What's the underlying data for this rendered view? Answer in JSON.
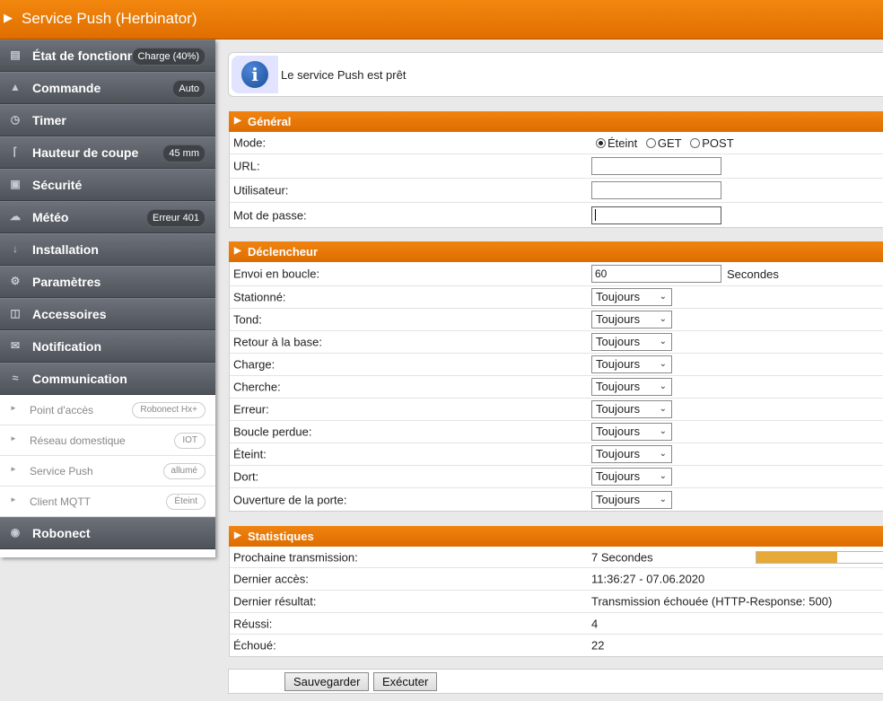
{
  "header": {
    "title": "Service Push (Herbinator)"
  },
  "sidebar": {
    "items": [
      {
        "label": "État de fonctionnement",
        "badge": "Charge (40%)",
        "icon": "chart-icon"
      },
      {
        "label": "Commande",
        "badge": "Auto",
        "icon": "joystick-icon"
      },
      {
        "label": "Timer",
        "badge": "",
        "icon": "clock-icon"
      },
      {
        "label": "Hauteur de coupe",
        "badge": "45 mm",
        "icon": "grass-icon"
      },
      {
        "label": "Sécurité",
        "badge": "",
        "icon": "lock-icon"
      },
      {
        "label": "Météo",
        "badge": "Erreur 401",
        "icon": "weather-icon"
      },
      {
        "label": "Installation",
        "badge": "",
        "icon": "install-icon"
      },
      {
        "label": "Paramètres",
        "badge": "",
        "icon": "gear-icon"
      },
      {
        "label": "Accessoires",
        "badge": "",
        "icon": "accessories-icon"
      },
      {
        "label": "Notification",
        "badge": "",
        "icon": "envelope-icon"
      },
      {
        "label": "Communication",
        "badge": "",
        "icon": "wifi-icon"
      }
    ],
    "subitems": [
      {
        "label": "Point d'accès",
        "badge": "Robonect Hx+"
      },
      {
        "label": "Réseau domestique",
        "badge": "IOT"
      },
      {
        "label": "Service Push",
        "badge": "allumé"
      },
      {
        "label": "Client MQTT",
        "badge": "Éteint"
      }
    ],
    "last": {
      "label": "Robonect",
      "icon": "robonect-icon"
    }
  },
  "info": {
    "message": "Le service Push est prêt"
  },
  "general": {
    "title": "Général",
    "mode_label": "Mode:",
    "mode_options": [
      "Éteint",
      "GET",
      "POST"
    ],
    "mode_selected": "Éteint",
    "url_label": "URL:",
    "url_value": "",
    "user_label": "Utilisateur:",
    "user_value": "",
    "password_label": "Mot de passe:",
    "password_value": ""
  },
  "trigger": {
    "title": "Déclencheur",
    "loop_label": "Envoi en boucle:",
    "loop_value": "60",
    "loop_unit": "Secondes",
    "rows": [
      {
        "label": "Stationné:",
        "value": "Toujours"
      },
      {
        "label": "Tond:",
        "value": "Toujours"
      },
      {
        "label": "Retour à la base:",
        "value": "Toujours"
      },
      {
        "label": "Charge:",
        "value": "Toujours"
      },
      {
        "label": "Cherche:",
        "value": "Toujours"
      },
      {
        "label": "Erreur:",
        "value": "Toujours"
      },
      {
        "label": "Boucle perdue:",
        "value": "Toujours"
      },
      {
        "label": "Éteint:",
        "value": "Toujours"
      },
      {
        "label": "Dort:",
        "value": "Toujours"
      },
      {
        "label": "Ouverture de la porte:",
        "value": "Toujours"
      }
    ]
  },
  "stats": {
    "title": "Statistiques",
    "rows": [
      {
        "label": "Prochaine transmission:",
        "value": "7 Secondes"
      },
      {
        "label": "Dernier accès:",
        "value": "11:36:27 - 07.06.2020"
      },
      {
        "label": "Dernier résultat:",
        "value": "Transmission échouée (HTTP-Response: 500)"
      },
      {
        "label": "Réussi:",
        "value": "4"
      },
      {
        "label": "Échoué:",
        "value": "22"
      }
    ],
    "progress_fraction": 0.57
  },
  "buttons": {
    "save": "Sauvegarder",
    "execute": "Exécuter"
  },
  "colors": {
    "accent": "#e87800",
    "sidebar": "#5a5f66",
    "progress": "#e6a935"
  }
}
